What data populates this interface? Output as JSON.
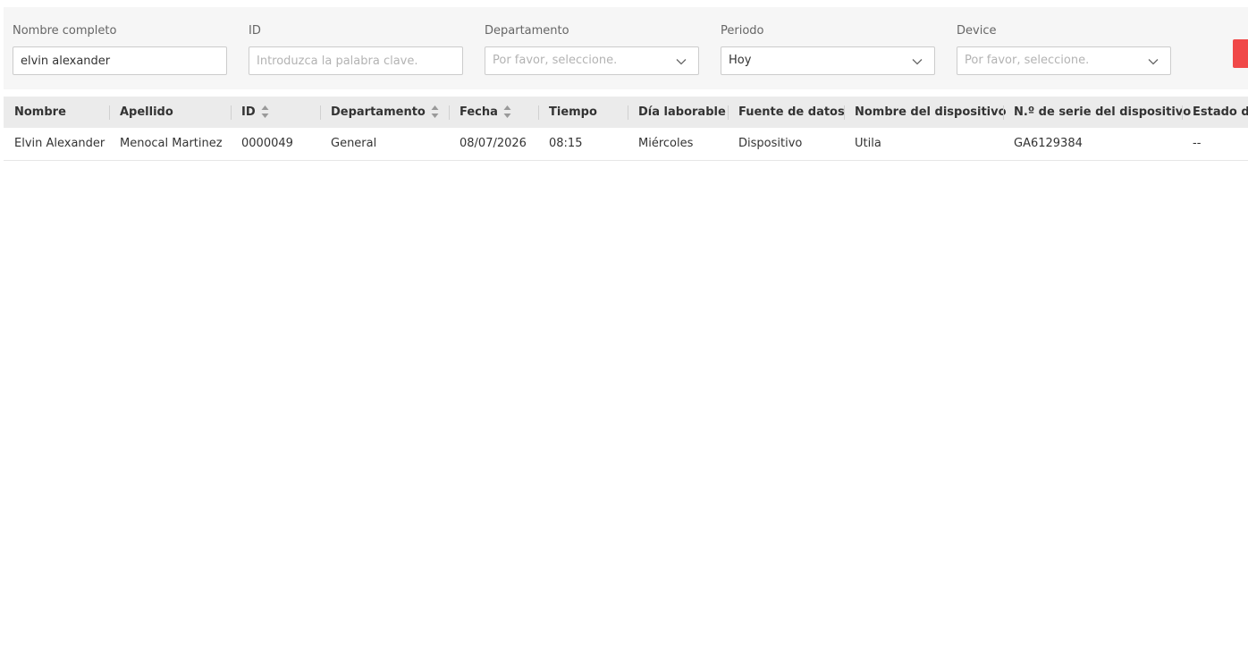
{
  "filters": {
    "full_name": {
      "label": "Nombre completo",
      "value": "elvin alexander",
      "placeholder": ""
    },
    "id": {
      "label": "ID",
      "value": "",
      "placeholder": "Introduzca la palabra clave."
    },
    "department": {
      "label": "Departamento",
      "selected": "Por favor, seleccione."
    },
    "period": {
      "label": "Periodo",
      "selected": "Hoy"
    },
    "device": {
      "label": "Device",
      "selected": "Por favor, seleccione."
    }
  },
  "colors": {
    "accent_button": "#f04848",
    "header_bg": "#ebebeb",
    "filter_bg": "#f6f6f6"
  },
  "table": {
    "columns": [
      "Nombre",
      "Apellido",
      "ID",
      "Departamento",
      "Fecha",
      "Tiempo",
      "Día laborable",
      "Fuente de datos",
      "Nombre del dispositivo",
      "N.º de serie del dispositivo",
      "Estado de"
    ],
    "rows": [
      [
        "Elvin Alexander",
        "Menocal Martinez",
        "0000049",
        "General",
        "08/07/2026",
        "08:15",
        "Miércoles",
        "Dispositivo",
        "Utila",
        "GA6129384",
        "--"
      ]
    ]
  }
}
